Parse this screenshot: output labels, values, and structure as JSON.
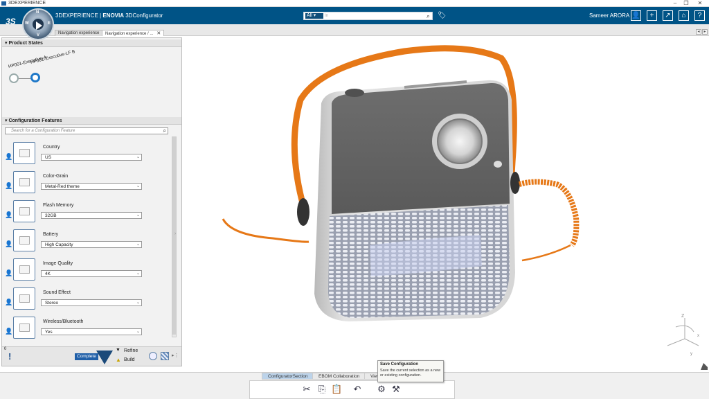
{
  "window": {
    "title": "3DEXPERIENCE"
  },
  "header": {
    "brand_prefix": "3DEXPERIENCE",
    "brand_sep": " | ",
    "brand_app_bold": "ENOVIA",
    "brand_app": " 3DConfigurator",
    "search": {
      "scope": "All",
      "placeholder": "In"
    },
    "user": "Sameer ARORA",
    "compass_letters": {
      "n": "N",
      "w": "W",
      "e": "E",
      "s": "S",
      "v": "V"
    }
  },
  "tabs": [
    {
      "label": "Navigation experience"
    },
    {
      "label": "Navigation experience / ..."
    }
  ],
  "product_states": {
    "title": "Product States",
    "states": [
      {
        "label": "HP001-Executive-A"
      },
      {
        "label": "HP001-Executive-LF B"
      }
    ]
  },
  "config_features": {
    "title": "Configuration Features",
    "search_placeholder": "Search for a Configuration Feature",
    "features": [
      {
        "name": "Country",
        "value": "US"
      },
      {
        "name": "Color-Grain",
        "value": "Metal-Red theme"
      },
      {
        "name": "Flash Memory",
        "value": "32GB"
      },
      {
        "name": "Battery",
        "value": "High Capacity"
      },
      {
        "name": "Image Quality",
        "value": "4K"
      },
      {
        "name": "Sound Effect",
        "value": "Stereo"
      },
      {
        "name": "Wireless/Bluetooth",
        "value": "Yes"
      }
    ]
  },
  "status": {
    "count": "0",
    "complete": "Complete",
    "refine": "Refine",
    "build": "Build"
  },
  "bottom_tabs": [
    {
      "label": "ConfiguratorSection"
    },
    {
      "label": "EBOM Collaboration"
    },
    {
      "label": "View"
    }
  ],
  "tooltip": {
    "title": "Save Configuration",
    "desc": "Save the current selection as a new or existing configuration."
  },
  "colors": {
    "header": "#005386",
    "handle": "#e67817",
    "accent": "#1e78c8"
  },
  "axis_labels": {
    "z": "Z",
    "x": "x",
    "y": "y"
  }
}
